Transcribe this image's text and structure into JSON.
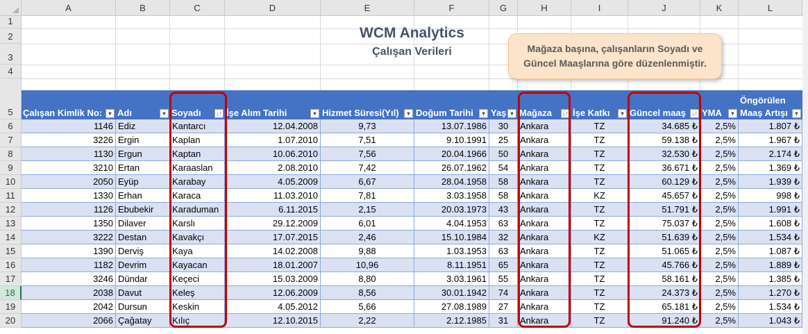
{
  "columns": [
    "A",
    "B",
    "C",
    "D",
    "E",
    "F",
    "G",
    "H",
    "I",
    "J",
    "K",
    "L"
  ],
  "row_numbers": [
    "1",
    "2",
    "3",
    "4",
    "5",
    "6",
    "7",
    "8",
    "9",
    "10",
    "11",
    "12",
    "13",
    "14",
    "15",
    "16",
    "17",
    "18",
    "19",
    "20"
  ],
  "selected_row": "18",
  "title": "WCM Analytics",
  "subtitle": "Çalışan Verileri",
  "callout": {
    "line1": "Mağaza başına, çalışanların Soyadı ve",
    "line2": "Güncel Maaşlarına göre düzenlenmiştir."
  },
  "headers": [
    {
      "label": "Çalışan Kimlik No:",
      "filter": "▾"
    },
    {
      "label": "Adı",
      "filter": "▾"
    },
    {
      "label": "Soyadı",
      "filter": "↓↑"
    },
    {
      "label": "İşe Alım Tarihi",
      "filter": "▾"
    },
    {
      "label": "Hizmet Süresi(Yıl)",
      "filter": "▾"
    },
    {
      "label": "Doğum Tarihi",
      "filter": "▾"
    },
    {
      "label": "Yaş",
      "filter": "▾"
    },
    {
      "label": "Mağaza",
      "filter": "↓↑"
    },
    {
      "label": "İşe Katkı",
      "filter": "▾"
    },
    {
      "label": "Güncel maaş",
      "filter": "↓↑"
    },
    {
      "label": "YMA",
      "filter": "▾"
    },
    {
      "label": "Maaş Artışı",
      "label_top": "Öngörülen",
      "filter": "▾"
    }
  ],
  "rows": [
    [
      "1146",
      "Ediz",
      "Kantarcı",
      "12.04.2008",
      "9,73",
      "13.07.1986",
      "30",
      "Ankara",
      "TZ",
      "34.685 ₺",
      "2,5%",
      "1.807 ₺"
    ],
    [
      "3226",
      "Ergin",
      "Kaplan",
      "1.07.2010",
      "7,51",
      "9.10.1991",
      "25",
      "Ankara",
      "TZ",
      "59.138 ₺",
      "2,5%",
      "1.967 ₺"
    ],
    [
      "1130",
      "Ergun",
      "Kaptan",
      "10.06.2010",
      "7,56",
      "20.04.1966",
      "50",
      "Ankara",
      "TZ",
      "32.530 ₺",
      "2,5%",
      "2.174 ₺"
    ],
    [
      "3210",
      "Ertan",
      "Karaaslan",
      "2.08.2010",
      "7,42",
      "26.07.1962",
      "54",
      "Ankara",
      "TZ",
      "36.671 ₺",
      "2,5%",
      "1.369 ₺"
    ],
    [
      "2050",
      "Eyüp",
      "Karabay",
      "4.05.2009",
      "6,67",
      "28.04.1958",
      "58",
      "Ankara",
      "TZ",
      "60.129 ₺",
      "2,5%",
      "1.939 ₺"
    ],
    [
      "1330",
      "Erhan",
      "Karaca",
      "11.03.2010",
      "7,81",
      "3.03.1958",
      "58",
      "Ankara",
      "KZ",
      "45.657 ₺",
      "2,5%",
      "998 ₺"
    ],
    [
      "1126",
      "Ebubekir",
      "Karaduman",
      "6.11.2015",
      "2,15",
      "20.03.1973",
      "43",
      "Ankara",
      "TZ",
      "51.791 ₺",
      "2,5%",
      "1.991 ₺"
    ],
    [
      "1350",
      "Dilaver",
      "Karslı",
      "29.12.2009",
      "6,01",
      "4.04.1953",
      "63",
      "Ankara",
      "TZ",
      "75.037 ₺",
      "2,5%",
      "1.608 ₺"
    ],
    [
      "3222",
      "Destan",
      "Kavakçı",
      "17.07.2015",
      "2,46",
      "15.10.1984",
      "32",
      "Ankara",
      "KZ",
      "51.639 ₺",
      "2,5%",
      "1.534 ₺"
    ],
    [
      "1390",
      "Derviş",
      "Kaya",
      "14.02.2008",
      "9,88",
      "1.03.1953",
      "63",
      "Ankara",
      "TZ",
      "51.065 ₺",
      "2,5%",
      "1.087 ₺"
    ],
    [
      "1182",
      "Devrim",
      "Kayacan",
      "18.01.2007",
      "10,96",
      "8.11.1951",
      "65",
      "Ankara",
      "TZ",
      "45.766 ₺",
      "2,5%",
      "1.889 ₺"
    ],
    [
      "3246",
      "Dündar",
      "Keçeci",
      "15.03.2009",
      "8,80",
      "3.03.1961",
      "55",
      "Ankara",
      "TZ",
      "58.161 ₺",
      "2,5%",
      "1.385 ₺"
    ],
    [
      "2038",
      "Davut",
      "Keleş",
      "12.06.2009",
      "8,56",
      "30.01.1942",
      "74",
      "Ankara",
      "TZ",
      "24.373 ₺",
      "2,5%",
      "1.270 ₺"
    ],
    [
      "2042",
      "Dursun",
      "Keskin",
      "4.05.2012",
      "5,66",
      "27.08.1989",
      "27",
      "Ankara",
      "TZ",
      "65.181 ₺",
      "2,5%",
      "1.534 ₺"
    ],
    [
      "2066",
      "Çağatay",
      "Kılıç",
      "12.10.2015",
      "2,22",
      "2.12.1985",
      "31",
      "Ankara",
      "TZ",
      "91.240 ₺",
      "2,5%",
      "1.043 ₺"
    ]
  ]
}
